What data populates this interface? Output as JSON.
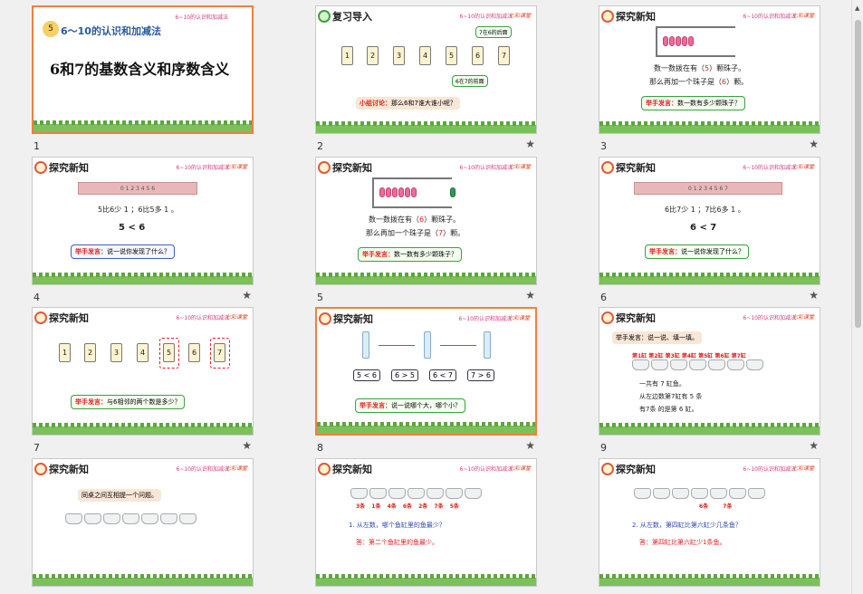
{
  "course": "6~10的认识和加减法",
  "brand": "七彩课堂",
  "slides": [
    {
      "num": "1",
      "badge": "5",
      "subtitle": "6～10的认识和加减法",
      "title": "6和7的基数含义和序数含义"
    },
    {
      "num": "2",
      "header": "复习导入",
      "cards": [
        "1",
        "2",
        "3",
        "4",
        "5",
        "6",
        "7"
      ],
      "tag_top": "7在6的后面",
      "tag_bot": "6在7的前面",
      "discuss_label": "小组讨论：",
      "discuss": "那么6和7谁大谁小呢？"
    },
    {
      "num": "3",
      "header": "探究新知",
      "line1a": "数一数拨在有（",
      "line1v": "5",
      "line1b": "）颗珠子。",
      "line2a": "那么再加一个珠子是（",
      "line2v": "6",
      "line2b": "）颗。",
      "speak_label": "举手发言：",
      "speak": "数一数有多少颗珠子？"
    },
    {
      "num": "4",
      "header": "探究新知",
      "ruler": "0 1 2 3 4 5 6",
      "line": "5比6少 1 ；6比5多 1 。",
      "cmp": "5 < 6",
      "speak_label": "举手发言：",
      "speak": "说一说你发现了什么？"
    },
    {
      "num": "5",
      "header": "探究新知",
      "line1a": "数一数拨在有（",
      "line1v": "6",
      "line1b": "）颗珠子。",
      "line2a": "那么再加一个珠子是（",
      "line2v": "7",
      "line2b": "）颗。",
      "speak_label": "举手发言：",
      "speak": "数一数有多少颗珠子？"
    },
    {
      "num": "6",
      "header": "探究新知",
      "ruler": "0 1 2 3 4 5 6 7",
      "line": "6比7少 1 ；7比6多 1 。",
      "cmp": "6 < 7",
      "speak_label": "举手发言：",
      "speak": "说一说你发现了什么？"
    },
    {
      "num": "7",
      "header": "探究新知",
      "cards": [
        "1",
        "2",
        "3",
        "4",
        "5",
        "6",
        "7"
      ],
      "speak_label": "举手发言：",
      "speak": "与6相邻的两个数是多少？"
    },
    {
      "num": "8",
      "header": "探究新知",
      "cmps": [
        "5 < 6",
        "6 > 5",
        "6 < 7",
        "7 > 6"
      ],
      "speak_label": "举手发言：",
      "speak": "说一说哪个大，哪个小？"
    },
    {
      "num": "9",
      "header": "探究新知",
      "prompt": "举手发言：说一说、填一填。",
      "labels": [
        "第1缸",
        "第2缸",
        "第3缸",
        "第4缸",
        "第5缸",
        "第6缸",
        "第7缸"
      ],
      "l1": "一共有 7 缸鱼。",
      "l2": "从左边数第7缸有 5 条",
      "l3": "有7条 的是第 6 缸。"
    },
    {
      "num": "10",
      "header": "探究新知",
      "prompt": "同桌之间互相提一个问题。"
    },
    {
      "num": "11",
      "header": "探究新知",
      "counts": [
        "3条",
        "1条",
        "4条",
        "6条",
        "2条",
        "7条",
        "5条"
      ],
      "q": "1. 从左数，哪个鱼缸里的鱼最少？",
      "a": "答：第二个鱼缸里的鱼最少。"
    },
    {
      "num": "12",
      "header": "探究新知",
      "counts": [
        "6条",
        "7条"
      ],
      "q": "2. 从左数，第四缸比第六缸少几条鱼？",
      "a": "答：第四缸比第六缸少1条鱼。"
    }
  ],
  "icons": {
    "star": "★",
    "scroll_up": "▲"
  }
}
